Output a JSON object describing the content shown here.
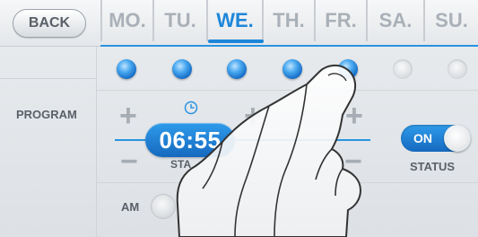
{
  "topbar": {
    "back_label": "BACK",
    "days": [
      {
        "label": "MO.",
        "active": false
      },
      {
        "label": "TU.",
        "active": false
      },
      {
        "label": "WE.",
        "active": true
      },
      {
        "label": "TH.",
        "active": false
      },
      {
        "label": "FR.",
        "active": false
      },
      {
        "label": "SA.",
        "active": false
      },
      {
        "label": "SU.",
        "active": false
      }
    ]
  },
  "sidebar": {
    "program_label": "PROGRAM"
  },
  "program": {
    "dots_on": [
      true,
      true,
      true,
      true,
      true,
      false,
      false
    ],
    "time": "06:55",
    "sta_label": "STA",
    "plus_glyph": "+",
    "minus_glyph": "−"
  },
  "status": {
    "toggle_label": "ON",
    "status_label": "STATUS"
  },
  "ampm": {
    "am_label": "AM"
  },
  "colors": {
    "accent": "#1d86d9",
    "inactive_day": "#a9b0b8"
  },
  "icons": {
    "clock": "clock-icon",
    "hand": "hand-gesture"
  }
}
